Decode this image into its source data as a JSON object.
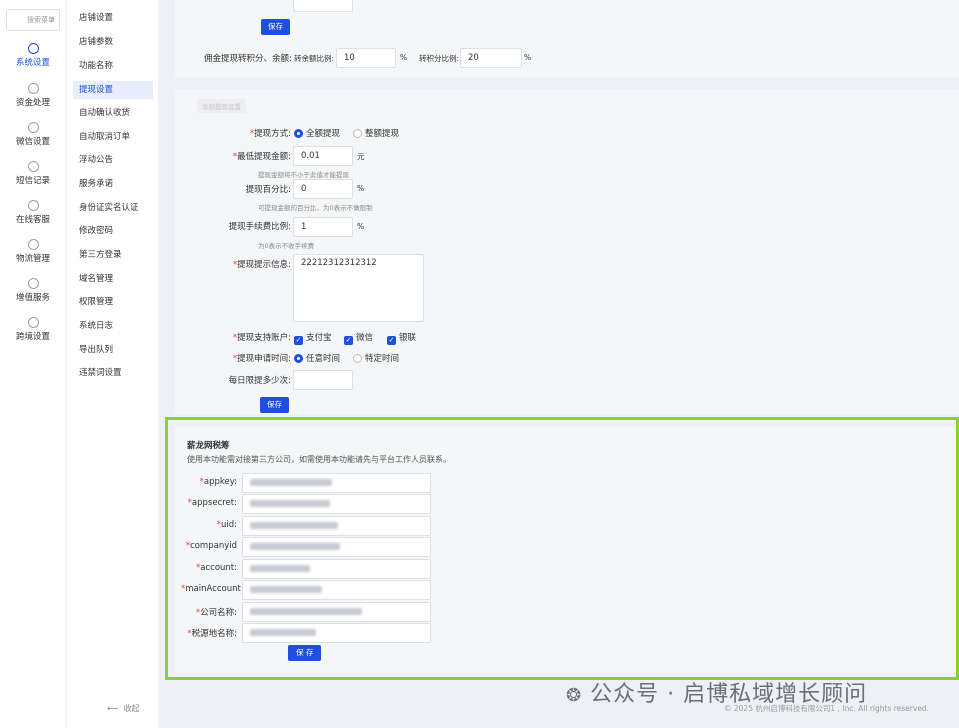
{
  "nav": {
    "search_placeholder": "搜索菜单",
    "items": [
      {
        "label": "系统设置",
        "icon": "gear-icon"
      },
      {
        "label": "资金处理",
        "icon": "yen-icon"
      },
      {
        "label": "微信设置",
        "icon": "wechat-icon"
      },
      {
        "label": "短信记录",
        "icon": "message-icon"
      },
      {
        "label": "在线客服",
        "icon": "headset-icon"
      },
      {
        "label": "物流管理",
        "icon": "truck-icon"
      },
      {
        "label": "增值服务",
        "icon": "chart-icon"
      },
      {
        "label": "跨境设置",
        "icon": "globe-icon"
      }
    ]
  },
  "submenu": {
    "items": [
      "店铺设置",
      "店铺参数",
      "功能名称",
      "提现设置",
      "自动确认收货",
      "自动取消订单",
      "浮动公告",
      "服务承诺",
      "身份证实名认证",
      "修改密码",
      "第三方登录",
      "域名管理",
      "权限管理",
      "系统日志",
      "导出队列",
      "违禁词设置"
    ],
    "active": "提现设置",
    "collapse": "收起"
  },
  "commission": {
    "save": "保存",
    "label": "佣金提现转积分、余额:",
    "balance_label": "转余额比例:",
    "balance_value": "10",
    "points_label": "转积分比例:",
    "points_value": "20",
    "percent": "%"
  },
  "withdraw": {
    "section_tab": "余额提现设置",
    "method_label": "提现方式:",
    "method_options": [
      "全额提现",
      "整额提现"
    ],
    "min_label": "最低提现金额:",
    "min_value": "0.01",
    "min_unit": "元",
    "min_hint": "提现金额将不小于此值才能提现",
    "pct_label": "提现百分比:",
    "pct_value": "0",
    "pct_hint": "可提现金额的百分比，为0表示不做限制",
    "fee_label": "提现手续费比例:",
    "fee_value": "1",
    "fee_hint": "为0表示不收手续费",
    "tip_label": "提现提示信息:",
    "tip_value": "22212312312312",
    "accounts_label": "提现支持账户:",
    "accounts": [
      "支付宝",
      "微信",
      "银联"
    ],
    "time_label": "提现申请时间:",
    "time_options": [
      "任意时间",
      "特定时间"
    ],
    "daily_label": "每日限提多少次:",
    "daily_value": "",
    "save": "保存",
    "percent": "%"
  },
  "tax": {
    "title": "薪龙网税筹",
    "desc": "使用本功能需对接第三方公司，如需使用本功能请先与平台工作人员联系。",
    "fields": [
      {
        "label": "appkey:",
        "value": ""
      },
      {
        "label": "appsecret:",
        "value": ""
      },
      {
        "label": "uid:",
        "value": ""
      },
      {
        "label": "companyid",
        "value": ""
      },
      {
        "label": "account:",
        "value": ""
      },
      {
        "label": "mainAccount",
        "value": ""
      },
      {
        "label": "公司名称:",
        "value": ""
      },
      {
        "label": "税源地名称:",
        "value": ""
      }
    ],
    "save": "保 存"
  },
  "footer": {
    "watermark": "公众号 · 启博私域增长顾问",
    "copyright": "© 2025 杭州启博科技有限公司1 , Inc. All rights reserved."
  },
  "colors": {
    "accent": "#1f4fe0",
    "highlight": "#8ad128",
    "required": "#f03d3d"
  }
}
